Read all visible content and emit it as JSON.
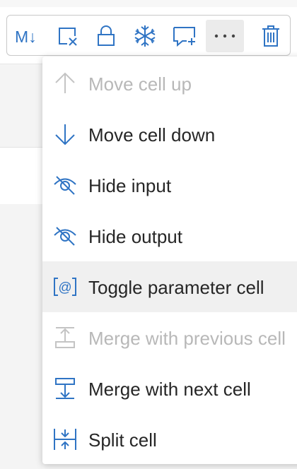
{
  "colors": {
    "accent": "#2f74c4",
    "text": "#262626",
    "disabled": "#b8b8b8",
    "hover_bg": "#f0f0f0"
  },
  "toolbar": {
    "buttons": [
      {
        "icon": "markdown-toggle-icon",
        "label": "M↓"
      },
      {
        "icon": "clear-output-icon"
      },
      {
        "icon": "lock-icon"
      },
      {
        "icon": "freeze-icon"
      },
      {
        "icon": "add-comment-icon"
      },
      {
        "icon": "more-icon",
        "label": "···",
        "active": true
      },
      {
        "icon": "delete-icon"
      }
    ]
  },
  "menu": {
    "items": [
      {
        "label": "Move cell up",
        "icon": "arrow-up-icon",
        "disabled": true
      },
      {
        "label": "Move cell down",
        "icon": "arrow-down-icon",
        "disabled": false
      },
      {
        "label": "Hide input",
        "icon": "eye-hidden-icon",
        "disabled": false
      },
      {
        "label": "Hide output",
        "icon": "eye-hidden-icon",
        "disabled": false
      },
      {
        "label": "Toggle parameter cell",
        "icon": "parameter-icon",
        "disabled": false,
        "hover": true
      },
      {
        "label": "Merge with previous cell",
        "icon": "merge-up-icon",
        "disabled": true
      },
      {
        "label": "Merge with next cell",
        "icon": "merge-down-icon",
        "disabled": false
      },
      {
        "label": "Split cell",
        "icon": "split-icon",
        "disabled": false
      }
    ]
  }
}
